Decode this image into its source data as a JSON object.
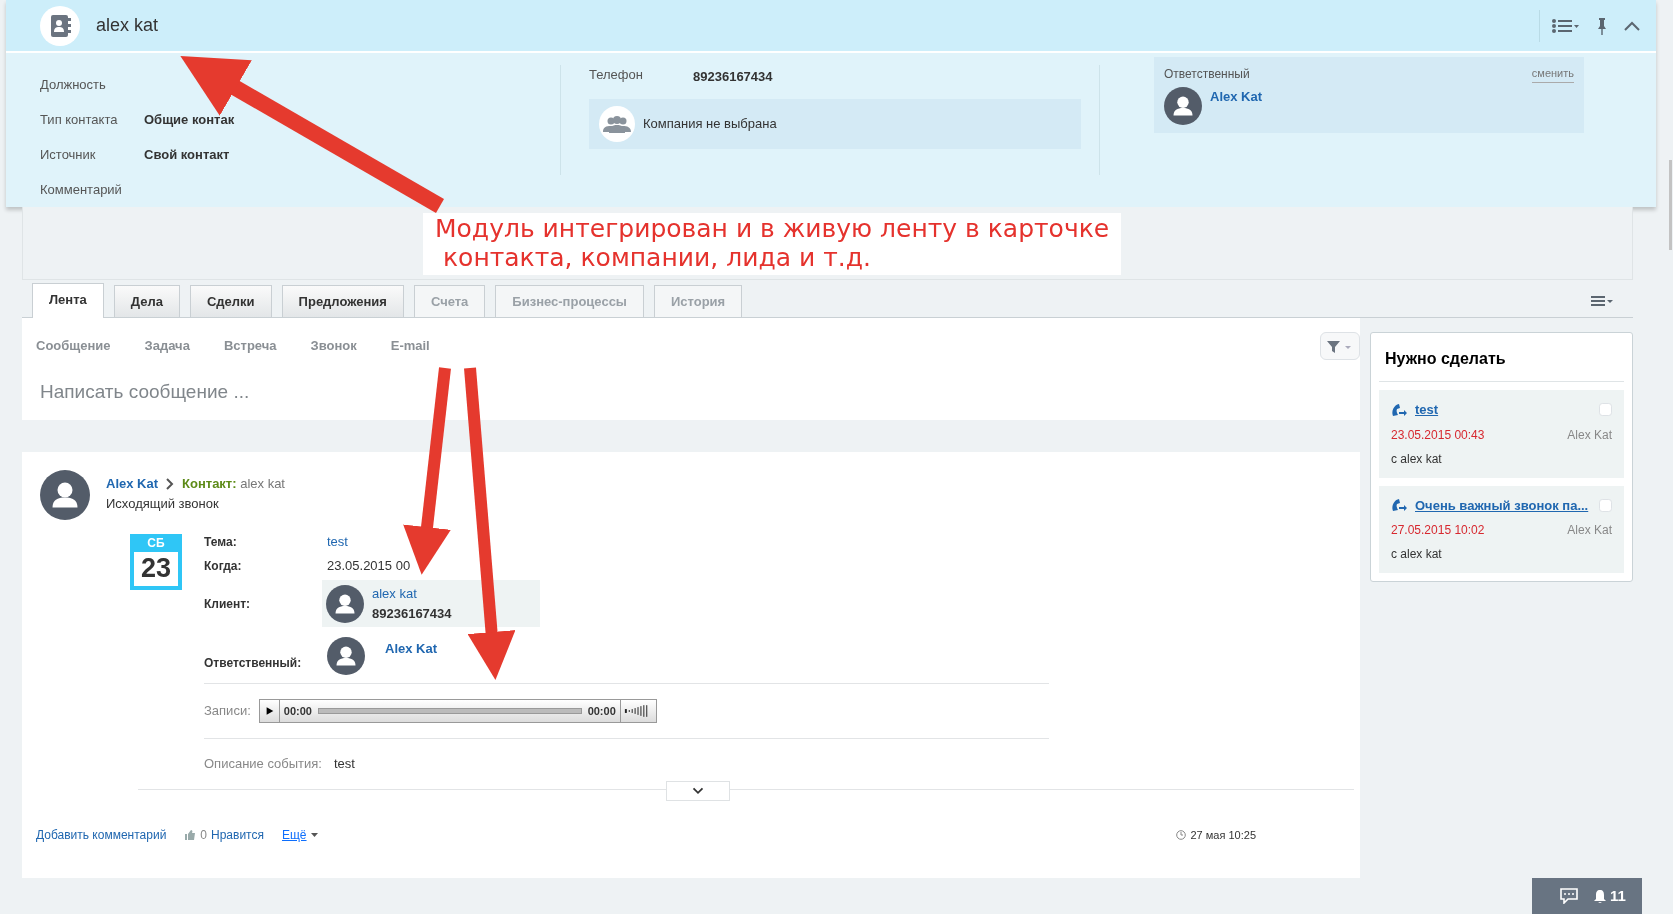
{
  "header": {
    "title": "alex kat",
    "fields": [
      {
        "label": "Должность"
      },
      {
        "label": "Тип контакта",
        "value": "Общие контак"
      },
      {
        "label": "Источник",
        "value": "Свой контакт"
      },
      {
        "label": "Комментарий"
      }
    ],
    "phone": {
      "label": "Телефон",
      "value": "89236167434"
    },
    "company": "Компания не выбрана",
    "responsible": {
      "label": "Ответственный",
      "action": "сменить",
      "name": "Alex Kat"
    }
  },
  "annotation": {
    "lines": [
      "Модуль интегрирован и в живую ленту в карточке",
      "контакта, компании, лида и т.д."
    ]
  },
  "tabs": [
    {
      "label": "Лента",
      "selected": true
    },
    {
      "label": "Дела",
      "selected": false
    },
    {
      "label": "Сделки",
      "selected": false
    },
    {
      "label": "Предложения",
      "selected": false
    },
    {
      "label": "Счета",
      "selected": false
    },
    {
      "label": "Бизнес-процессы",
      "selected": false
    },
    {
      "label": "История",
      "selected": false
    }
  ],
  "actions": [
    "Сообщение",
    "Задача",
    "Встреча",
    "Звонок",
    "E-mail"
  ],
  "composer": {
    "placeholder": "Написать сообщение ..."
  },
  "post": {
    "author": "Alex Kat",
    "entity_label": "Контакт:",
    "entity": "alex kat",
    "subtitle": "Исходящий звонок",
    "calendar": {
      "weekday": "СБ",
      "day": "23"
    },
    "fields": [
      {
        "label": "Тема:",
        "value": "test"
      },
      {
        "label": "Когда:",
        "value": "23.05.2015 00"
      }
    ],
    "client": {
      "label": "Клиент:",
      "name": "alex kat",
      "phone": "89236167434"
    },
    "responsible": {
      "label": "Ответственный:",
      "name": "Alex Kat"
    },
    "records": {
      "label": "Записи:",
      "elapsed": "00:00",
      "total": "00:00",
      "level": 0
    },
    "description": {
      "label": "Описание события:",
      "value": "test"
    },
    "comment_link": "Добавить комментарий",
    "likes": "0",
    "like_label": "Нравится",
    "more": "Ещё",
    "time": "27 мая 10:25"
  },
  "todo": {
    "title": "Нужно сделать",
    "items": [
      {
        "title": "test",
        "date": "23.05.2015 00:43",
        "owner": "Alex Kat",
        "contact": "с alex kat",
        "checked": false
      },
      {
        "title": "Очень важный звонок па...",
        "date": "27.05.2015 10:02",
        "owner": "Alex Kat",
        "contact": "с alex kat",
        "checked": false
      }
    ]
  },
  "bottom_bar": {
    "notifications": "11"
  }
}
